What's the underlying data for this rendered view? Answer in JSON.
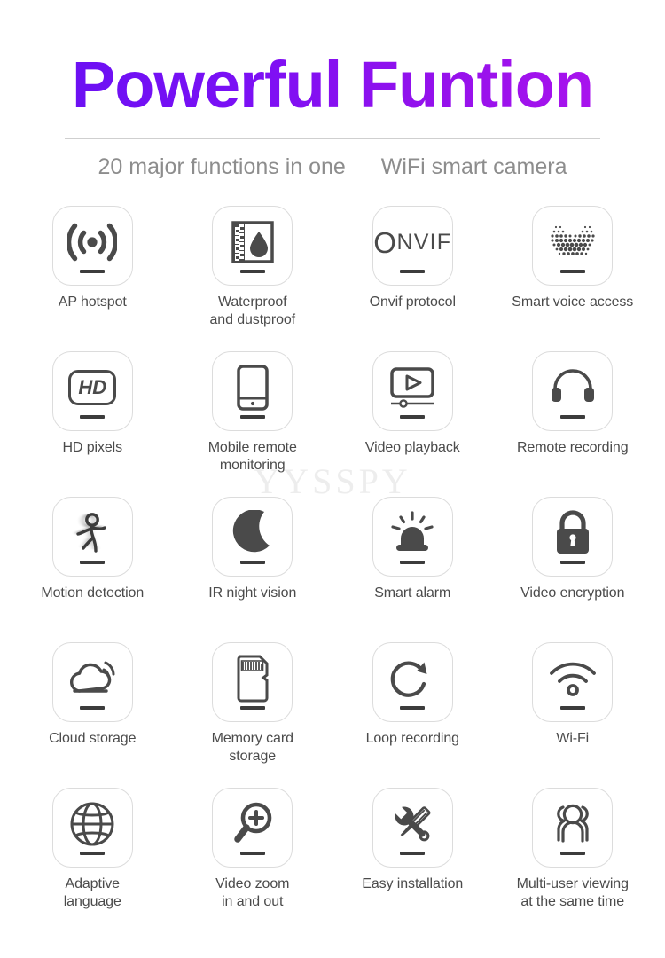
{
  "header": {
    "title": "Powerful Funtion",
    "subtitle_left": "20 major functions in one",
    "subtitle_right": "WiFi smart camera",
    "gradient_start": "#6610f2",
    "gradient_end": "#b114ee",
    "subtitle_color": "#8d8d8d",
    "divider_color": "#cfcfcf"
  },
  "watermark": {
    "text": "YYSSPY",
    "color": "#ededed"
  },
  "styles": {
    "card_border_color": "#dcdcdc",
    "icon_color": "#4a4a4a",
    "label_color": "#4b4b4b",
    "dash_color": "#3c3c3c",
    "background": "#ffffff"
  },
  "features": [
    {
      "icon": "wifi-broadcast-icon",
      "label": "AP hotspot"
    },
    {
      "icon": "waterproof-droplet-icon",
      "label": "Waterproof\nand dustproof"
    },
    {
      "icon": "onvif-wordmark-icon",
      "label": "Onvif protocol",
      "wordmark_o": "O",
      "wordmark_rest": "NVIF"
    },
    {
      "icon": "voice-dot-matrix-icon",
      "label": "Smart voice access"
    },
    {
      "icon": "hd-badge-icon",
      "label": "HD pixels",
      "wordmark": "HD"
    },
    {
      "icon": "smartphone-icon",
      "label": "Mobile remote\nmonitoring"
    },
    {
      "icon": "video-playback-icon",
      "label": "Video playback"
    },
    {
      "icon": "headset-icon",
      "label": "Remote recording"
    },
    {
      "icon": "running-person-icon",
      "label": "Motion detection"
    },
    {
      "icon": "crescent-moon-icon",
      "label": "IR night vision"
    },
    {
      "icon": "alarm-siren-icon",
      "label": "Smart alarm"
    },
    {
      "icon": "padlock-icon",
      "label": "Video encryption"
    },
    {
      "icon": "cloud-signal-icon",
      "label": "Cloud storage"
    },
    {
      "icon": "memory-card-icon",
      "label": "Memory card\nstorage"
    },
    {
      "icon": "loop-arrow-icon",
      "label": "Loop recording"
    },
    {
      "icon": "wifi-icon",
      "label": "Wi-Fi"
    },
    {
      "icon": "globe-icon",
      "label": "Adaptive\nlanguage"
    },
    {
      "icon": "magnifier-plus-icon",
      "label": "Video zoom\nin and out"
    },
    {
      "icon": "wrench-screwdriver-icon",
      "label": "Easy installation"
    },
    {
      "icon": "multi-user-icon",
      "label": "Multi-user viewing\nat the same time"
    }
  ]
}
